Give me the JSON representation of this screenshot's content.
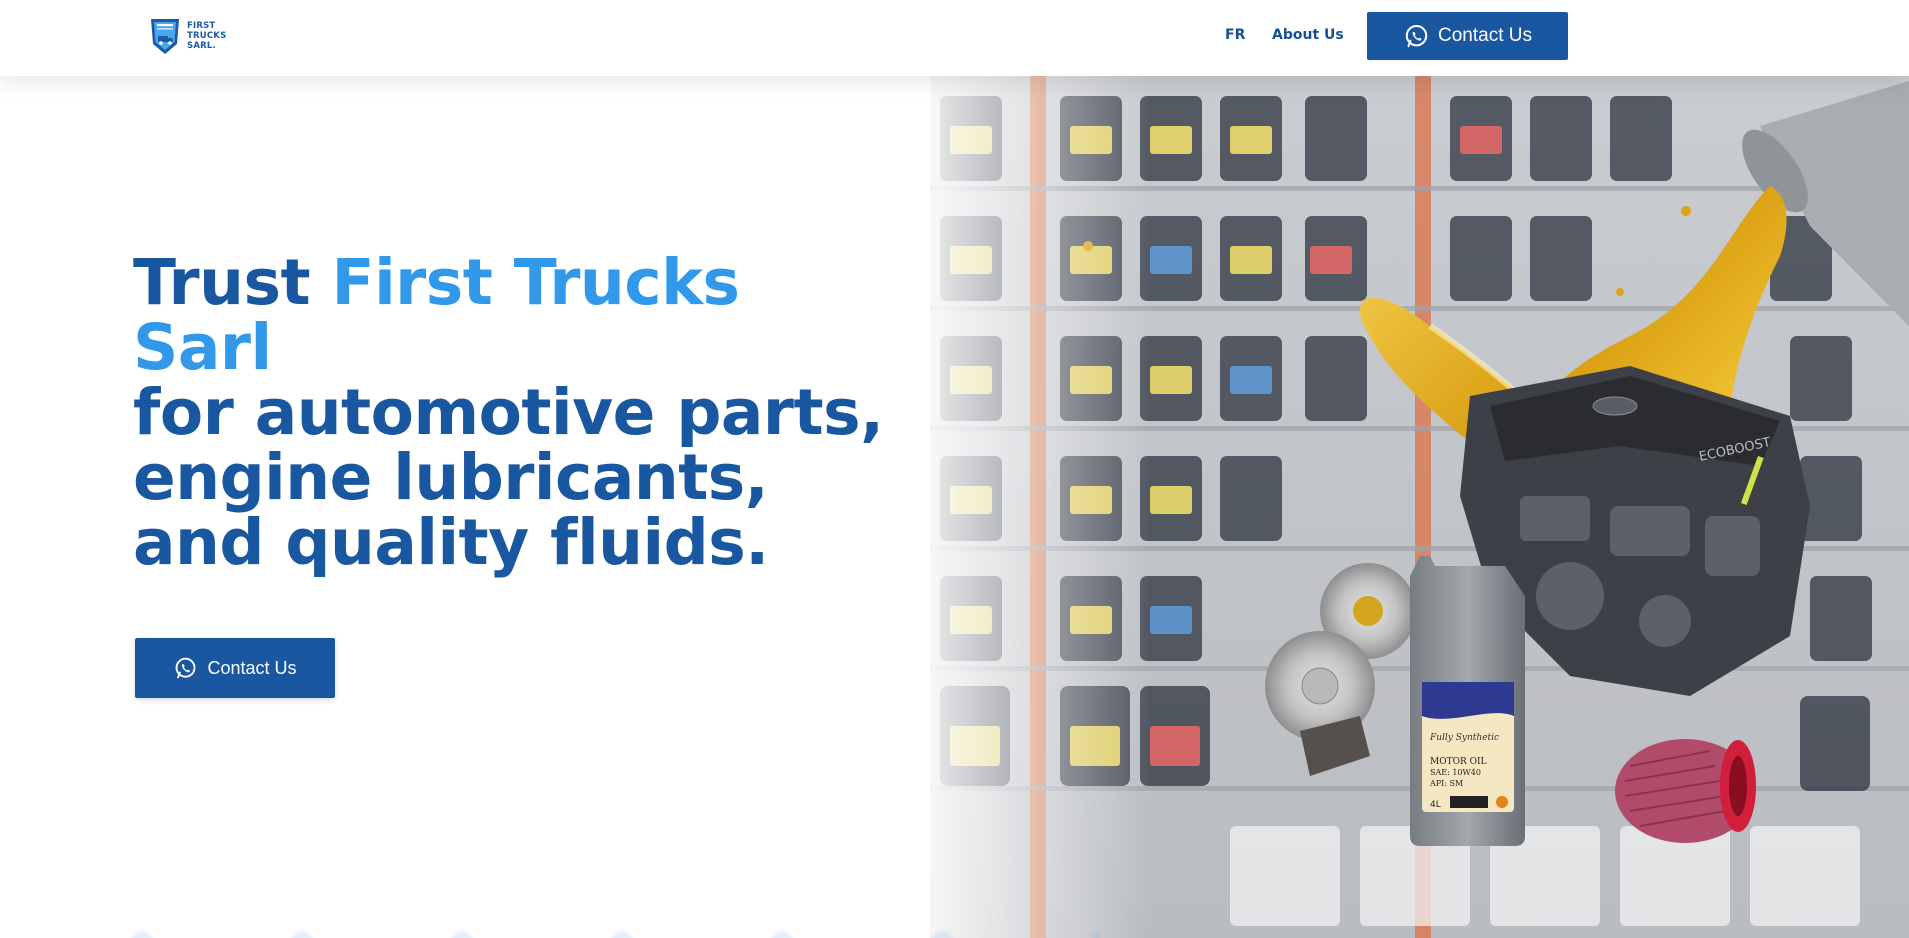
{
  "brand": {
    "name_lines": [
      "FIRST",
      "TRUCKS",
      "SARL."
    ]
  },
  "nav": {
    "language": "FR",
    "about": "About Us",
    "contact": "Contact Us"
  },
  "hero": {
    "title_prefix": "Trust ",
    "title_highlight": "First Trucks Sarl",
    "title_rest": "for automotive parts, engine lubricants, and quality fluids.",
    "cta": "Contact Us",
    "image_product_label": {
      "line1": "Fully Synthetic",
      "line2": "MOTOR OIL",
      "line3": "SAE: 10W40",
      "line4": "API: SM",
      "volume": "4L"
    },
    "engine_cover_text": "ECOBOOST"
  },
  "colors": {
    "primary": "#1a57a1",
    "highlight": "#3198ea",
    "background": "#ffffff"
  },
  "icons": {
    "contact": "whatsapp-icon"
  }
}
